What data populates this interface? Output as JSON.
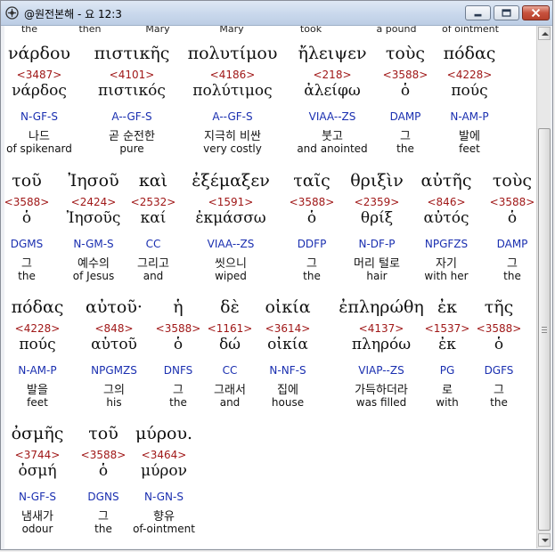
{
  "window": {
    "title": "@원전본해 - 요 12:3"
  },
  "previous_row": [
    "the",
    "then",
    "Mary",
    "Mary",
    "took",
    "a pound",
    "of ointment"
  ],
  "rows": [
    {
      "words": [
        {
          "greek": "νάρδου",
          "strong": "<3487>",
          "lemma": "νάρδος",
          "parse": "N-GF-S",
          "korean": "나드",
          "english": "of spikenard"
        },
        {
          "greek": "πιστικῆς",
          "strong": "<4101>",
          "lemma": "πιστικός",
          "parse": "A--GF-S",
          "korean": "곧 순전한",
          "english": "pure"
        },
        {
          "greek": "πολυτίμου",
          "strong": "<4186>",
          "lemma": "πολύτιμος",
          "parse": "A--GF-S",
          "korean": "지극히 비싼",
          "english": "very costly"
        },
        {
          "greek": "ἤλειψεν",
          "strong": "<218>",
          "lemma": "ἀλείφω",
          "parse": "VIAA--ZS",
          "korean": "붓고",
          "english": "and anointed"
        },
        {
          "greek": "τοὺς",
          "strong": "<3588>",
          "lemma": "ὁ",
          "parse": "DAMP",
          "korean": "그",
          "english": "the"
        },
        {
          "greek": "πόδας",
          "strong": "<4228>",
          "lemma": "πούς",
          "parse": "N-AM-P",
          "korean": "발에",
          "english": "feet"
        }
      ]
    },
    {
      "words": [
        {
          "greek": "τοῦ",
          "strong": "<3588>",
          "lemma": "ὁ",
          "parse": "DGMS",
          "korean": "그",
          "english": "the"
        },
        {
          "greek": "Ἰησοῦ",
          "strong": "<2424>",
          "lemma": "Ἰησοῦς",
          "parse": "N-GM-S",
          "korean": "예수의",
          "english": "of Jesus"
        },
        {
          "greek": "καὶ",
          "strong": "<2532>",
          "lemma": "καί",
          "parse": "CC",
          "korean": "그리고",
          "english": "and"
        },
        {
          "greek": "ἐξέμαξεν",
          "strong": "<1591>",
          "lemma": "ἐκμάσσω",
          "parse": "VIAA--ZS",
          "korean": "씻으니",
          "english": "wiped"
        },
        {
          "greek": "ταῖς",
          "strong": "<3588>",
          "lemma": "ὁ",
          "parse": "DDFP",
          "korean": "그",
          "english": "the"
        },
        {
          "greek": "θριξὶν",
          "strong": "<2359>",
          "lemma": "θρίξ",
          "parse": "N-DF-P",
          "korean": "머리 털로",
          "english": "hair"
        },
        {
          "greek": "αὐτῆς",
          "strong": "<846>",
          "lemma": "αὐτός",
          "parse": "NPGFZS",
          "korean": "자기",
          "english": "with her"
        },
        {
          "greek": "τοὺς",
          "strong": "<3588>",
          "lemma": "ὁ",
          "parse": "DAMP",
          "korean": "그",
          "english": "the"
        }
      ]
    },
    {
      "words": [
        {
          "greek": "πόδας",
          "strong": "<4228>",
          "lemma": "πούς",
          "parse": "N-AM-P",
          "korean": "발을",
          "english": "feet"
        },
        {
          "greek": "αὐτοῦ·",
          "strong": "<848>",
          "lemma": "αὑτοῦ",
          "parse": "NPGMZS",
          "korean": "그의",
          "english": "his"
        },
        {
          "greek": "ἡ",
          "strong": "<3588>",
          "lemma": "ὁ",
          "parse": "DNFS",
          "korean": "그",
          "english": "the"
        },
        {
          "greek": "δὲ",
          "strong": "<1161>",
          "lemma": "δώ",
          "parse": "CC",
          "korean": "그래서",
          "english": "and"
        },
        {
          "greek": "οἰκία",
          "strong": "<3614>",
          "lemma": "οἰκία",
          "parse": "N-NF-S",
          "korean": "집에",
          "english": "house"
        },
        {
          "greek": "ἐπληρώθη",
          "strong": "<4137>",
          "lemma": "πληρόω",
          "parse": "VIAP--ZS",
          "korean": "가득하더라",
          "english": "was filled"
        },
        {
          "greek": "ἐκ",
          "strong": "<1537>",
          "lemma": "ἐκ",
          "parse": "PG",
          "korean": "로",
          "english": "with"
        },
        {
          "greek": "τῆς",
          "strong": "<3588>",
          "lemma": "ὁ",
          "parse": "DGFS",
          "korean": "그",
          "english": "the"
        }
      ]
    },
    {
      "words": [
        {
          "greek": "ὀσμῆς",
          "strong": "<3744>",
          "lemma": "ὀσμή",
          "parse": "N-GF-S",
          "korean": "냄새가",
          "english": "odour"
        },
        {
          "greek": "τοῦ",
          "strong": "<3588>",
          "lemma": "ὁ",
          "parse": "DGNS",
          "korean": "그",
          "english": "the"
        },
        {
          "greek": "μύρου.",
          "strong": "<3464>",
          "lemma": "μύρον",
          "parse": "N-GN-S",
          "korean": "향유",
          "english": "of-ointment"
        }
      ]
    }
  ]
}
